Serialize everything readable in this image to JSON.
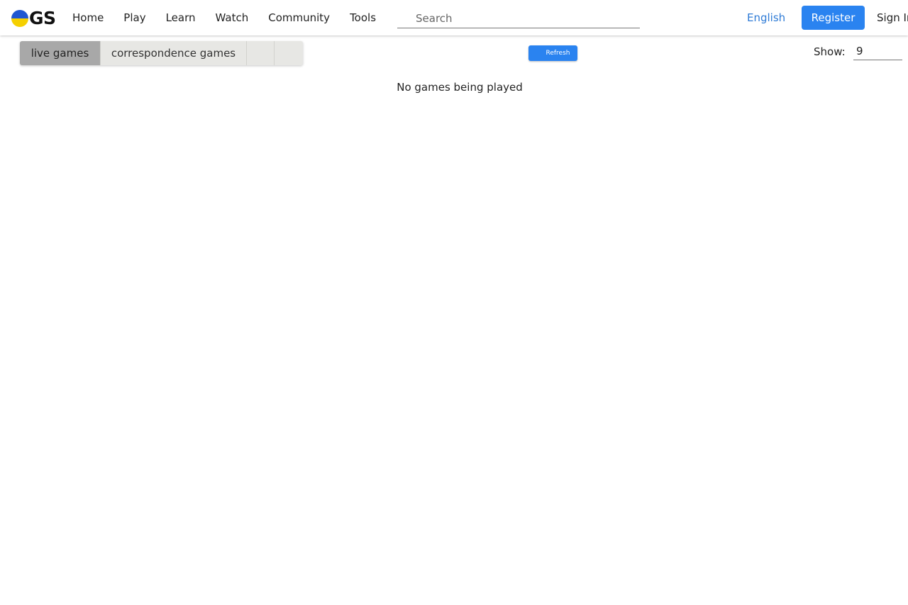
{
  "brand": {
    "logo_text": "GS",
    "logo_colors": {
      "top": "#1f57d1",
      "bottom": "#f5d000"
    }
  },
  "nav": {
    "links": [
      "Home",
      "Play",
      "Learn",
      "Watch",
      "Community",
      "Tools"
    ]
  },
  "search": {
    "placeholder": "Search",
    "value": ""
  },
  "header_right": {
    "language": "English",
    "register_label": "Register",
    "signin_label": "Sign In"
  },
  "tabs": {
    "live": "live games",
    "correspondence": "correspondence games",
    "empty_1": "",
    "empty_2": ""
  },
  "toolbar": {
    "refresh_label": "Refresh",
    "show_label": "Show:",
    "show_value": "9"
  },
  "content": {
    "empty_message": "No games being played"
  },
  "colors": {
    "accent": "#2a83f0",
    "link": "#2e7bd6",
    "active_tab": "#a8a8a8",
    "tab_bg": "#e7e7e4"
  }
}
